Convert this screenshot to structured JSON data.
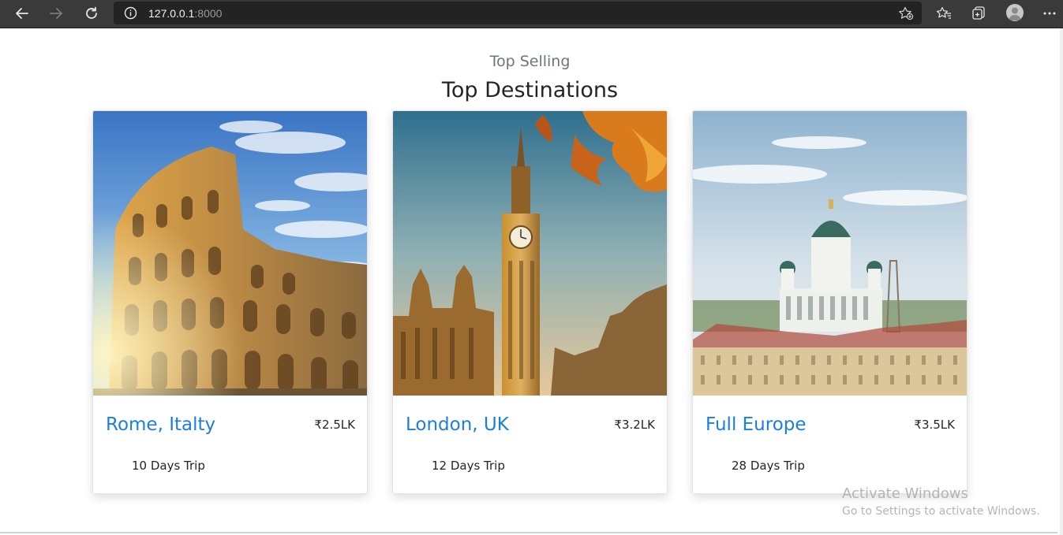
{
  "browser": {
    "url_host": "127.0.0.1",
    "url_port": ":8000",
    "icons": [
      "back-arrow-icon",
      "forward-arrow-icon",
      "refresh-icon",
      "info-icon",
      "add-favorite-icon",
      "favorites-icon",
      "collections-icon",
      "profile-icon",
      "more-icon"
    ]
  },
  "section": {
    "eyebrow": "Top Selling",
    "heading": "Top Destinations"
  },
  "destinations": [
    {
      "title": "Rome, Italty",
      "price": "₹2.5LK",
      "duration": "10 Days Trip",
      "image": "colosseum"
    },
    {
      "title": "London, UK",
      "price": "₹3.2LK",
      "duration": "12 Days Trip",
      "image": "big-ben"
    },
    {
      "title": "Full Europe",
      "price": "₹3.5LK",
      "duration": "28 Days Trip",
      "image": "helsinki-cathedral"
    }
  ],
  "watermark": {
    "line1": "Activate Windows",
    "line2": "Go to Settings to activate Windows."
  },
  "colors": {
    "title_link": "#1a7fe0",
    "toolbar": "#3a3a3a",
    "urlbar": "#232323"
  }
}
